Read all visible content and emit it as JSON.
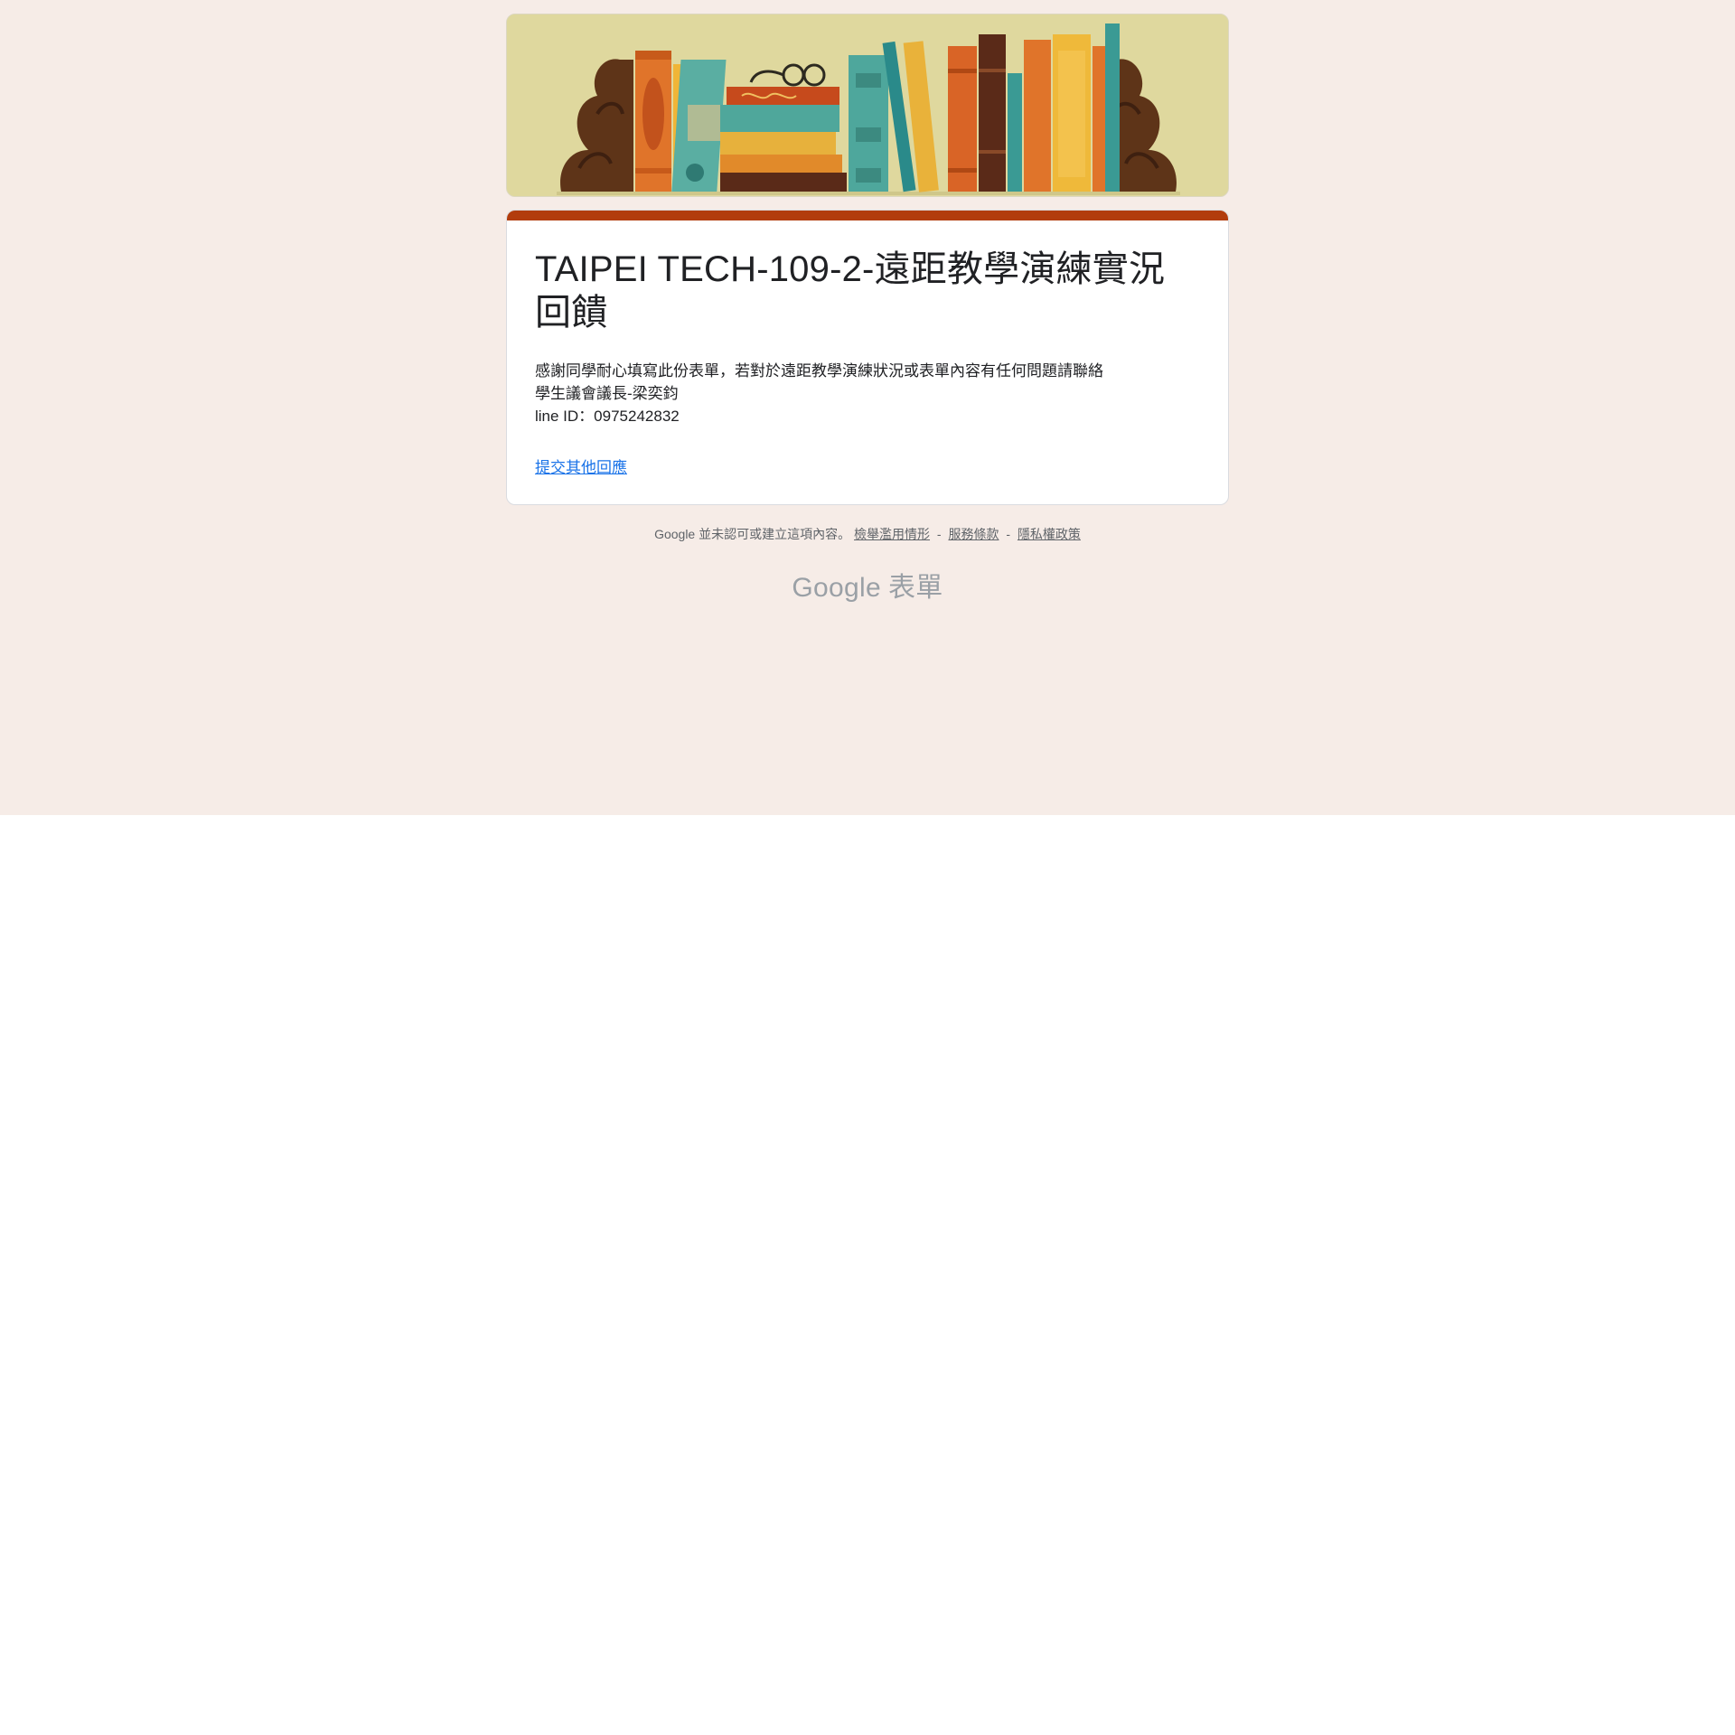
{
  "header": {
    "banner_icon": "bookshelf-illustration"
  },
  "form": {
    "accent_color": "#b23c0c",
    "title": "TAIPEI TECH-109-2-遠距教學演練實況回饋",
    "description_lines": [
      "感謝同學耐心填寫此份表單，若對於遠距教學演練狀況或表單內容有任何問題請聯絡",
      "學生議會議長-梁奕鈞",
      "line ID：0975242832"
    ],
    "resubmit_link": "提交其他回應"
  },
  "footer": {
    "disclaimer": "Google 並未認可或建立這項內容。",
    "report_abuse": "檢舉濫用情形",
    "terms": "服務條款",
    "privacy": "隱私權政策",
    "separator": "-"
  },
  "brand": {
    "google": "Google",
    "forms": "表單"
  }
}
